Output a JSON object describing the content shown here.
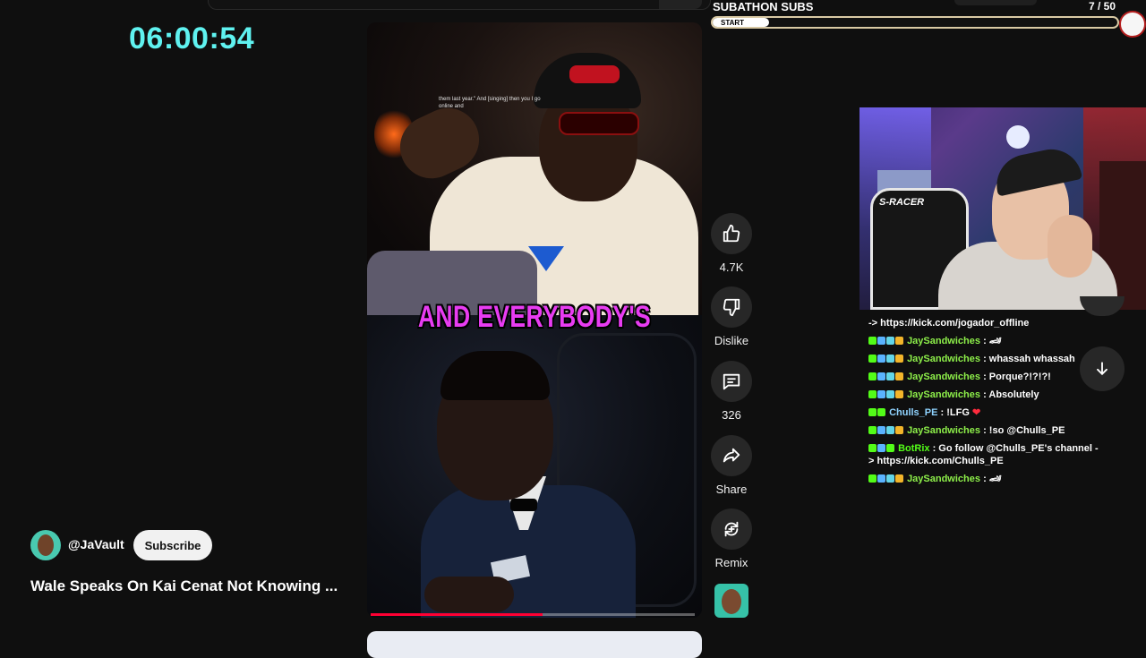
{
  "timer": "06:00:54",
  "video": {
    "caption": "AND EVERYBODY'S",
    "small_caption": "them last year.\" And [singing] then you I go online and",
    "progress": 0.53
  },
  "actions": {
    "like_count": "4.7K",
    "dislike_label": "Dislike",
    "comment_count": "326",
    "share_label": "Share",
    "remix_label": "Remix"
  },
  "channel": {
    "handle": "@JaVault",
    "subscribe_label": "Subscribe",
    "title": "Wale Speaks On Kai Cenat Not Knowing ..."
  },
  "subathon": {
    "title": "SUBATHON SUBS",
    "count": "7 / 50",
    "start_label": "START",
    "progress": 0.14
  },
  "webcam": {
    "chair_text": "S-RACER"
  },
  "chat": {
    "messages": [
      {
        "user": "",
        "text": "-> https://kick.com/jogador_offline"
      },
      {
        "user": "JaySandwiches",
        "text": ": 🏎"
      },
      {
        "user": "JaySandwiches",
        "text": ": whassah whassah"
      },
      {
        "user": "JaySandwiches",
        "text": ": Porque?!?!?!"
      },
      {
        "user": "JaySandwiches",
        "text": ": Absolutely"
      },
      {
        "user": "Chulls_PE",
        "text": ": !LFG",
        "emote": "❤"
      },
      {
        "user": "JaySandwiches",
        "text": ": !so @Chulls_PE"
      },
      {
        "user": "BotRix",
        "text": ": Go follow @Chulls_PE's channel -> https://kick.com/Chulls_PE"
      },
      {
        "user": "JaySandwiches",
        "text": ": 🏎"
      }
    ]
  },
  "colors": {
    "timer": "#5ff2f0",
    "caption": "#e83cf2",
    "progress": "#ff0033",
    "chat_user": "#8ef04a",
    "kick_green": "#53fc18"
  },
  "icons": [
    "thumbs-up-icon",
    "thumbs-down-icon",
    "comment-icon",
    "share-icon",
    "remix-icon",
    "arrow-down-icon"
  ]
}
